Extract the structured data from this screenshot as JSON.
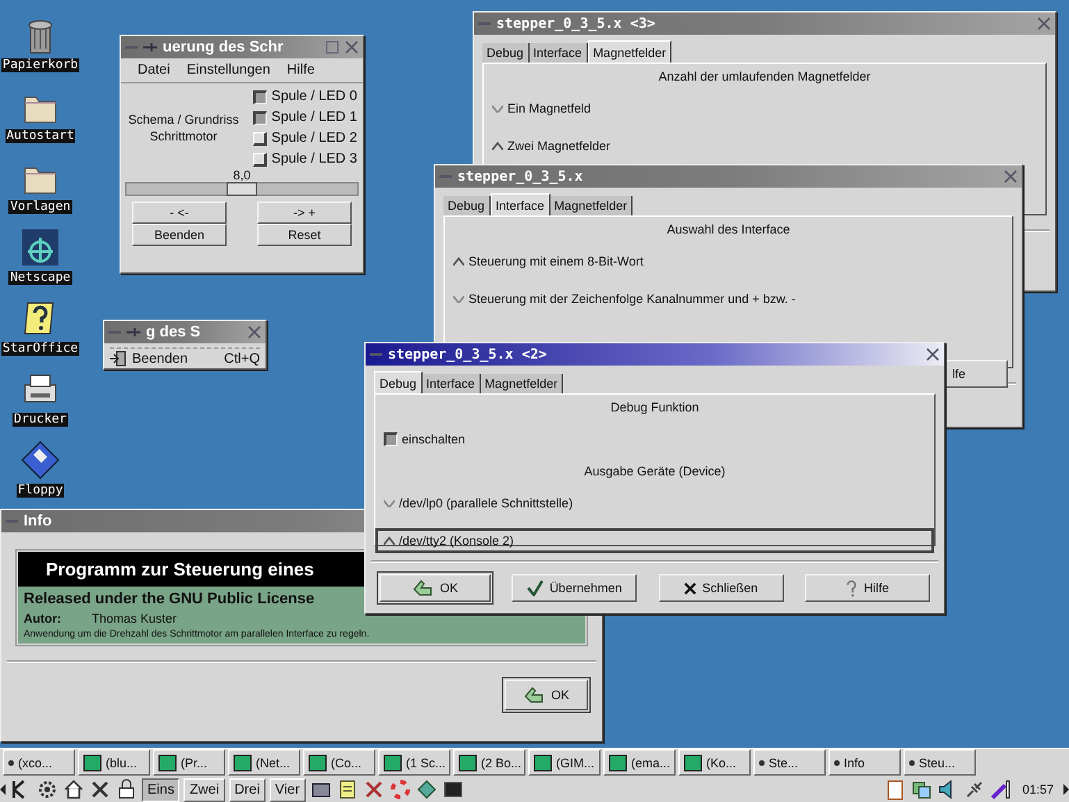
{
  "desktop_icons": [
    {
      "label": "Papierkorb",
      "kind": "trash"
    },
    {
      "label": "Autostart",
      "kind": "folder"
    },
    {
      "label": "Vorlagen",
      "kind": "folder"
    },
    {
      "label": "Netscape",
      "kind": "browser"
    },
    {
      "label": "StarOffice",
      "kind": "help"
    },
    {
      "label": "Drucker",
      "kind": "printer"
    },
    {
      "label": "Floppy",
      "kind": "floppy"
    }
  ],
  "control_window": {
    "title": "uerung des Schr",
    "menu": [
      "Datei",
      "Einstellungen",
      "Hilfe"
    ],
    "diagram_label": "Schema / Grundriss Schrittmotor",
    "coils": [
      {
        "label": "Spule / LED 0",
        "checked": true
      },
      {
        "label": "Spule / LED 1",
        "checked": true
      },
      {
        "label": "Spule / LED 2",
        "checked": false
      },
      {
        "label": "Spule / LED 3",
        "checked": false
      }
    ],
    "slider": {
      "reading": "8,0",
      "level": 0.5
    },
    "buttons": [
      "- <-",
      "-> +",
      "Beenden",
      "Reset"
    ]
  },
  "menu_window": {
    "title": "g des S",
    "items": [
      {
        "label": "Beenden",
        "shortcut": "Ctl+Q"
      }
    ]
  },
  "tab_windows": [
    {
      "title": "stepper_0_3_5.x <3>",
      "active": false,
      "tabs": [
        {
          "label": "Debug",
          "selected": false
        },
        {
          "label": "Interface",
          "selected": false
        },
        {
          "label": "Magnetfelder",
          "selected": true
        }
      ],
      "rows": [
        {
          "kind": "heading",
          "label": "Anzahl der umlaufenden Magnetfelder"
        },
        {
          "kind": "radio",
          "label": "Ein Magnetfeld",
          "selected": false
        },
        {
          "kind": "radio",
          "label": "Zwei Magnetfelder",
          "selected": true
        }
      ]
    },
    {
      "title": "stepper_0_3_5.x",
      "active": false,
      "tabs": [
        {
          "label": "Debug",
          "selected": false
        },
        {
          "label": "Interface",
          "selected": true
        },
        {
          "label": "Magnetfelder",
          "selected": false
        }
      ],
      "rows": [
        {
          "kind": "heading",
          "label": "Auswahl des Interface"
        },
        {
          "kind": "radio",
          "label": "Steuerung mit einem 8-Bit-Wort",
          "selected": true
        },
        {
          "kind": "radio",
          "label": "Steuerung mit der Zeichenfolge Kanalnummer und + bzw. -",
          "selected": false
        }
      ],
      "buttons": [
        {
          "label": "lfe",
          "kind": "plain"
        }
      ]
    },
    {
      "title": "stepper_0_3_5.x <2>",
      "active": true,
      "tabs": [
        {
          "label": "Debug",
          "selected": true
        },
        {
          "label": "Interface",
          "selected": false
        },
        {
          "label": "Magnetfelder",
          "selected": false
        }
      ],
      "rows": [
        {
          "kind": "heading",
          "label": "Debug Funktion"
        },
        {
          "kind": "checkbox",
          "label": "einschalten",
          "checked": true
        },
        {
          "kind": "heading",
          "label": "Ausgabe Geräte (Device)"
        },
        {
          "kind": "radio",
          "label": "/dev/lp0 (parallele Schnittstelle)",
          "selected": false
        },
        {
          "kind": "radio",
          "label": "/dev/tty2 (Konsole 2)",
          "selected": true
        }
      ],
      "buttons": [
        {
          "label": "OK",
          "kind": "ok"
        },
        {
          "label": "Übernehmen",
          "kind": "apply"
        },
        {
          "label": "Schließen",
          "kind": "close"
        },
        {
          "label": "Hilfe",
          "kind": "help"
        }
      ]
    }
  ],
  "info_window": {
    "title": "Info",
    "banner": "Programm zur Steuerung eines",
    "license": "Released under the GNU Public License",
    "author_label": "Autor:",
    "author": "Thomas Kuster",
    "description": "Anwendung um die Drehzahl des Schrittmotor am parallelen Interface zu regeln.",
    "button": "OK"
  },
  "taskbar": {
    "tasks": [
      {
        "label": "(xco...",
        "kind": "dot"
      },
      {
        "label": "(blu...",
        "kind": "app"
      },
      {
        "label": "(Pr...",
        "kind": "app"
      },
      {
        "label": "(Net...",
        "kind": "app"
      },
      {
        "label": "(Co...",
        "kind": "app"
      },
      {
        "label": "(1 Sc...",
        "kind": "app"
      },
      {
        "label": "(2 Bo...",
        "kind": "app"
      },
      {
        "label": "(GIM...",
        "kind": "app"
      },
      {
        "label": "(ema...",
        "kind": "app"
      },
      {
        "label": "(Ko...",
        "kind": "app"
      },
      {
        "label": "Ste...",
        "kind": "dot"
      },
      {
        "label": "Info",
        "kind": "dot"
      },
      {
        "label": "Steu...",
        "kind": "dot"
      }
    ],
    "desktops": [
      {
        "label": "Eins",
        "selected": true
      },
      {
        "label": "Zwei",
        "selected": false
      },
      {
        "label": "Drei",
        "selected": false
      },
      {
        "label": "Vier",
        "selected": false
      }
    ],
    "clock": "01:57"
  }
}
